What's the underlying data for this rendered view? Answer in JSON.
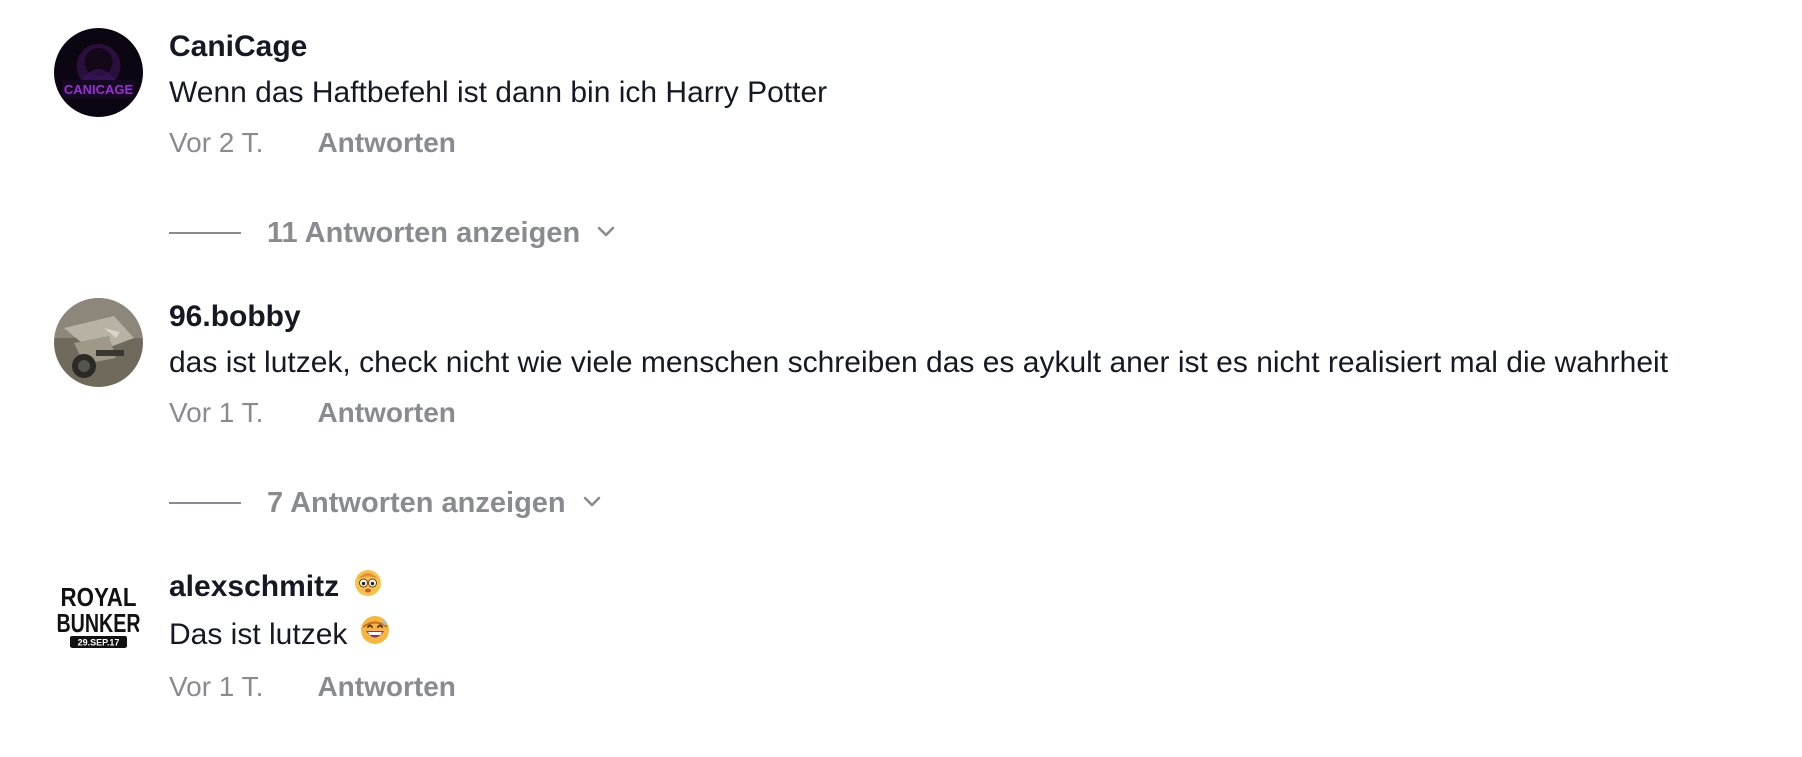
{
  "comments": [
    {
      "username": "CaniCage",
      "avatar_text": "CANICAGE",
      "text": "Wenn das Haftbefehl ist dann bin ich Harry Potter",
      "time": "Vor 2 T.",
      "reply_label": "Antworten",
      "replies_toggle": "11 Antworten anzeigen"
    },
    {
      "username": "96.bobby",
      "text": "das ist lutzek, check nicht wie viele menschen schreiben das es aykult aner ist es nicht realisiert mal die wahrheit",
      "time": "Vor 1 T.",
      "reply_label": "Antworten",
      "replies_toggle": "7 Antworten anzeigen"
    },
    {
      "username": "alexschmitz",
      "avatar_text_line1": "ROYAL",
      "avatar_text_line2": "BUNKER",
      "avatar_text_line3": "29.SEP.17",
      "text": "Das ist lutzek",
      "time": "Vor 1 T.",
      "reply_label": "Antworten"
    }
  ],
  "colors": {
    "text_primary": "#161823",
    "text_secondary": "#8a8b91",
    "background": "#ffffff"
  },
  "icons": {
    "chevron": "chevron-down-icon",
    "emoji_badge": "face-emoji-icon",
    "emoji_inline": "grinning-sweat-emoji-icon"
  }
}
